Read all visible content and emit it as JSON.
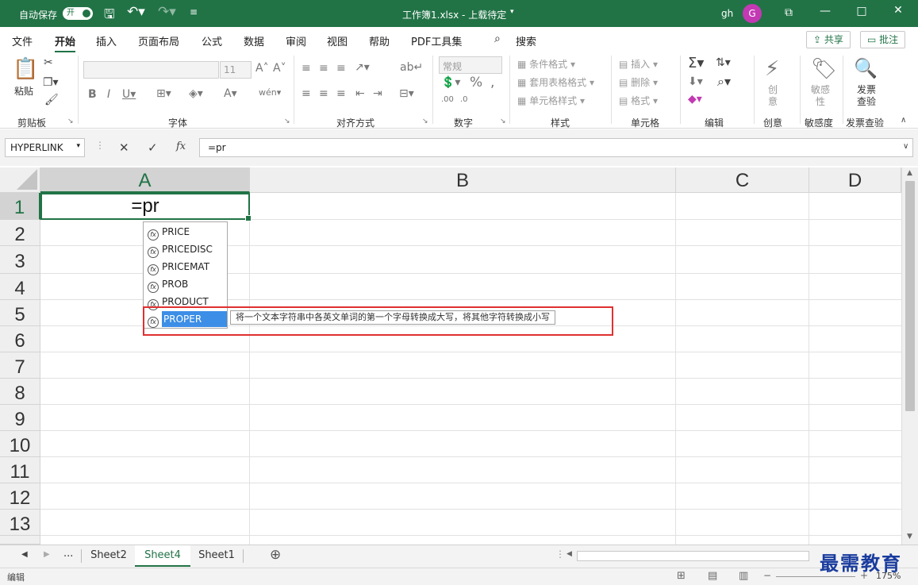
{
  "titlebar": {
    "autosave_label": "自动保存",
    "autosave_state": "开",
    "file_title": "工作簿1.xlsx  -  上载待定",
    "user_initials": "gh",
    "avatar_letter": "G"
  },
  "menu": {
    "tabs": [
      "文件",
      "开始",
      "插入",
      "页面布局",
      "公式",
      "数据",
      "审阅",
      "视图",
      "帮助",
      "PDF工具集",
      "搜索"
    ],
    "active_tab": "开始",
    "share_label": "共享",
    "comment_label": "批注"
  },
  "ribbon": {
    "groups": [
      "剪贴板",
      "字体",
      "对齐方式",
      "数字",
      "样式",
      "单元格",
      "编辑",
      "创意",
      "敏感度",
      "发票查验"
    ],
    "paste_label": "粘贴",
    "font_size": "11",
    "number_format": "常规",
    "style_items": [
      "条件格式",
      "套用表格格式",
      "单元格样式"
    ],
    "cell_items": [
      "插入",
      "删除",
      "格式"
    ],
    "creative_label": "创意",
    "sensitivity_label": "敏感性",
    "invoice_label": "发票查验"
  },
  "formula_bar": {
    "name_box": "HYPERLINK",
    "fx_label": "fx",
    "formula": "=pr"
  },
  "grid": {
    "columns": [
      "A",
      "B",
      "C",
      "D"
    ],
    "rows": [
      "1",
      "2",
      "3",
      "4",
      "5",
      "6",
      "7",
      "8",
      "9",
      "10",
      "11",
      "12",
      "13"
    ],
    "active_cell_value": "=pr"
  },
  "autocomplete": {
    "items": [
      "PRICE",
      "PRICEDISC",
      "PRICEMAT",
      "PROB",
      "PRODUCT",
      "PROPER"
    ],
    "selected": "PROPER",
    "tooltip": "将一个文本字符串中各英文单词的第一个字母转换成大写，将其他字符转换成小写"
  },
  "sheets": {
    "ellipsis": "...",
    "tabs": [
      "Sheet2",
      "Sheet4",
      "Sheet1"
    ],
    "active": "Sheet4"
  },
  "status": {
    "mode": "编辑",
    "zoom": "175%"
  },
  "watermark": "最需教育",
  "colors": {
    "accent": "#217346",
    "highlight": "#3c8ee6",
    "annotation": "#e03030"
  }
}
